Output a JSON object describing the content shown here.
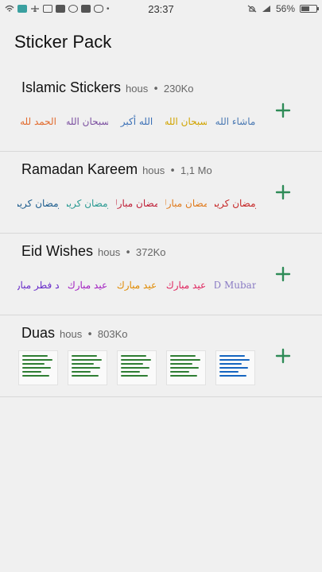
{
  "status_bar": {
    "time": "23:37",
    "battery": "56%",
    "battery_level": 0.56,
    "left_icons": [
      "wifi-icon",
      "message-icon",
      "airplane-icon",
      "instagram-icon",
      "youtube-icon",
      "whatsapp-icon",
      "facebook-icon",
      "wechat-icon",
      "more-icon"
    ],
    "right_icons": [
      "alarm-off-icon",
      "signal-icon"
    ]
  },
  "app": {
    "title": "Sticker Pack"
  },
  "packs": [
    {
      "name": "Islamic Stickers",
      "author": "hous",
      "separator": "•",
      "size": "230Ko",
      "stickers": [
        {
          "text": "الحمد لله",
          "color": "#e26c2f"
        },
        {
          "text": "سبحان الله",
          "color": "#7b4fa0"
        },
        {
          "text": "الله أكبر",
          "color": "#3a6fb6"
        },
        {
          "text": "سبحان الله",
          "color": "#d1a400"
        },
        {
          "text": "ماشاء الله",
          "color": "#4a79b3"
        }
      ]
    },
    {
      "name": "Ramadan Kareem",
      "author": "hous",
      "separator": "•",
      "size": "1,1 Mo",
      "stickers": [
        {
          "text": "رمضان كريم",
          "color": "#1d5d8e"
        },
        {
          "text": "رمضان كريم",
          "color": "#2a9a92"
        },
        {
          "text": "رمضان مبارك",
          "color": "#c0223a"
        },
        {
          "text": "رمضان مبارك",
          "color": "#e07b1d"
        },
        {
          "text": "رمضان كريم",
          "color": "#c62828"
        }
      ]
    },
    {
      "name": "Eid Wishes",
      "author": "hous",
      "separator": "•",
      "size": "372Ko",
      "stickers": [
        {
          "text": "عيد فطر مبارك",
          "color": "#6a2ec9"
        },
        {
          "text": "عيد مبارك",
          "color": "#a21fc1"
        },
        {
          "text": "عيد مبارك",
          "color": "#e08a00"
        },
        {
          "text": "عيد مبارك",
          "color": "#e0245e"
        },
        {
          "text": "EID Mubarak",
          "color": "#8a7bc4"
        }
      ]
    },
    {
      "name": "Duas",
      "author": "hous",
      "separator": "•",
      "size": "803Ko",
      "stickers": [
        {
          "text": "",
          "color": "#2e7d32"
        },
        {
          "text": "",
          "color": "#2e7d32"
        },
        {
          "text": "",
          "color": "#2e7d32"
        },
        {
          "text": "",
          "color": "#2e7d32"
        },
        {
          "text": "",
          "color": "#1565c0"
        }
      ]
    }
  ],
  "colors": {
    "accent": "#2e8b57",
    "background": "#f0f0f0",
    "divider": "#d8d8d8"
  }
}
